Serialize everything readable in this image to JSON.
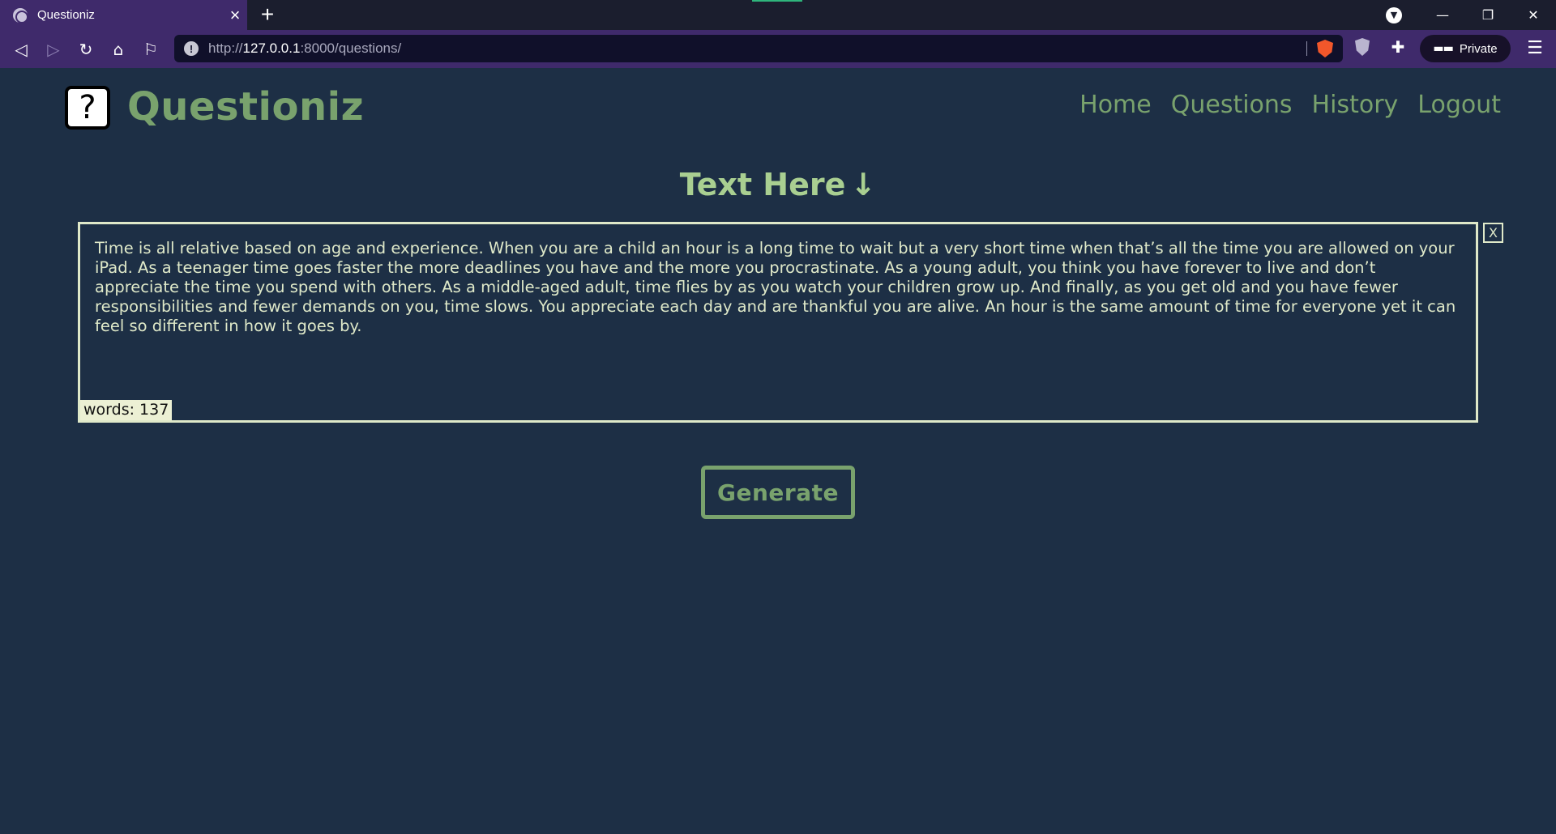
{
  "browser": {
    "tab_title": "Questioniz",
    "tab_close": "×",
    "new_tab": "+",
    "url_prefix": "http://",
    "url_host": "127.0.0.1",
    "url_rest": ":8000/questions/",
    "private_label": "Private",
    "icons": [
      "globe-icon",
      "back-icon",
      "forward-icon",
      "reload-icon",
      "home-icon",
      "bookmark-icon",
      "warning-icon",
      "brave-shield-icon",
      "shield-icon",
      "extensions-icon",
      "private-glasses-icon",
      "menu-icon",
      "minimize-icon",
      "restore-icon",
      "close-icon"
    ]
  },
  "header": {
    "logo_symbol": "?",
    "brand": "Questioniz",
    "nav": [
      "Home",
      "Questions",
      "History",
      "Logout"
    ]
  },
  "main": {
    "title": "Text Here",
    "title_arrow": "↓",
    "text": "Time is all relative based on age and experience. When you are a child an hour is a long time to wait but a very short time when that’s all the time you are allowed on your iPad. As a teenager time goes faster the more deadlines you have and the more you procrastinate. As a young adult, you think you have forever to live and don’t appreciate the time you spend with others. As a middle-aged adult, time flies by as you watch your children grow up. And finally, as you get old and you have fewer responsibilities and fewer demands on you, time slows. You appreciate each day and are thankful you are alive. An hour is the same amount of time for everyone yet it can feel so different in how it goes by.",
    "word_count_label": "words: ",
    "word_count": "137",
    "clear_label": "X",
    "generate_label": "Generate"
  },
  "colors": {
    "page_bg": "#1d2f45",
    "accent_green": "#79a26d",
    "light_green": "#a9cf91",
    "text_cream": "#dfe9c9",
    "browser_purple": "#3f2a6b"
  }
}
